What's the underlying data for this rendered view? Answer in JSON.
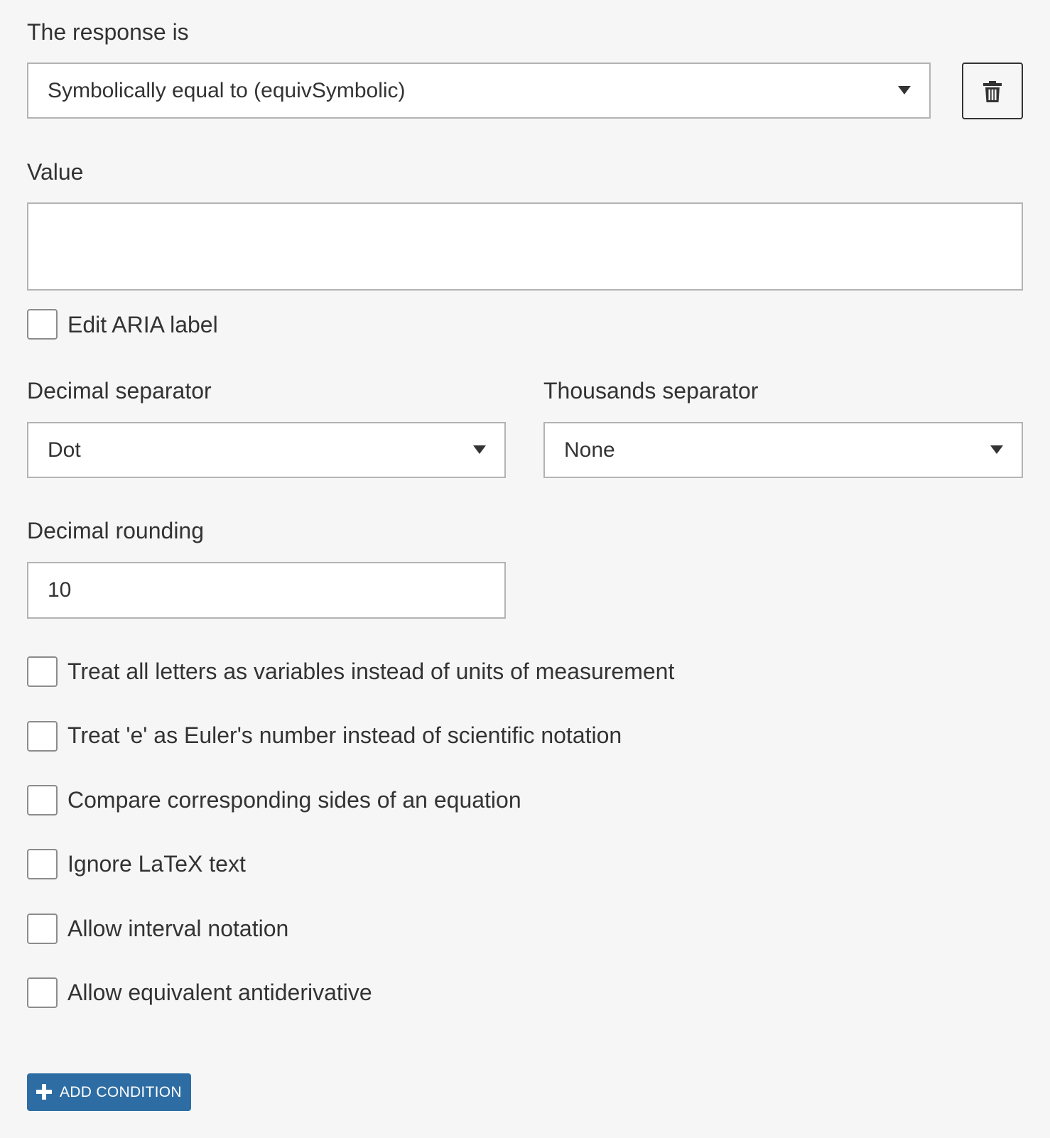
{
  "response": {
    "label": "The response is",
    "selected": "Symbolically equal to (equivSymbolic)",
    "delete_icon": "trash-icon"
  },
  "value": {
    "label": "Value",
    "current": ""
  },
  "aria": {
    "label": "Edit ARIA label",
    "checked": false
  },
  "decimal_separator": {
    "label": "Decimal separator",
    "selected": "Dot"
  },
  "thousands_separator": {
    "label": "Thousands separator",
    "selected": "None"
  },
  "decimal_rounding": {
    "label": "Decimal rounding",
    "value": "10"
  },
  "options": [
    {
      "label": "Treat all letters as variables instead of units of measurement",
      "checked": false
    },
    {
      "label": "Treat 'e' as Euler's number instead of scientific notation",
      "checked": false
    },
    {
      "label": "Compare corresponding sides of an equation",
      "checked": false
    },
    {
      "label": "Ignore LaTeX text",
      "checked": false
    },
    {
      "label": "Allow interval notation",
      "checked": false
    },
    {
      "label": "Allow equivalent antiderivative",
      "checked": false
    }
  ],
  "add_condition": {
    "label": "ADD CONDITION",
    "icon": "plus-icon"
  },
  "colors": {
    "background": "#f6f6f6",
    "text": "#333333",
    "field_border": "#b3b3b3",
    "button_blue": "#2e6da4"
  }
}
